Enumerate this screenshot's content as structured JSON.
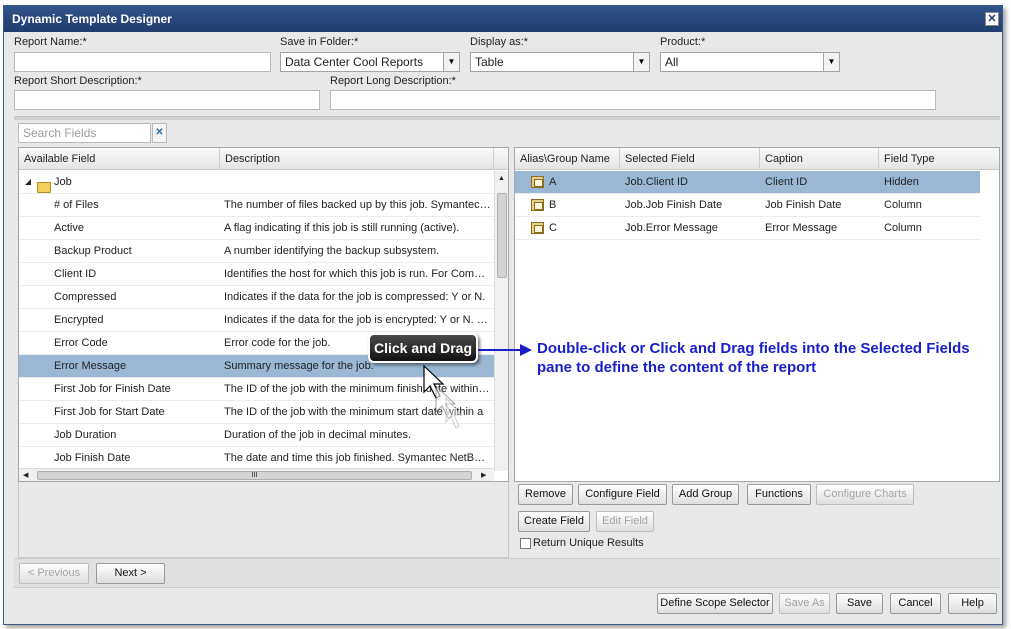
{
  "window": {
    "title": "Dynamic Template Designer",
    "close_glyph": "✕"
  },
  "form": {
    "report_name_label": "Report Name:*",
    "report_name_value": "",
    "save_in_folder_label": "Save in Folder:*",
    "save_in_folder_value": "Data Center Cool Reports",
    "display_as_label": "Display as:*",
    "display_as_value": "Table",
    "product_label": "Product:*",
    "product_value": "All",
    "short_desc_label": "Report Short Description:*",
    "short_desc_value": "",
    "long_desc_label": "Report Long Description:*",
    "long_desc_value": ""
  },
  "search": {
    "placeholder": "Search Fields",
    "clear_glyph": "✕"
  },
  "available": {
    "headers": [
      "Available Field",
      "Description"
    ],
    "group": "Job",
    "rows": [
      {
        "field": "# of Files",
        "desc": "The number of files backed up by this job. Symantec NetBackup"
      },
      {
        "field": "Active",
        "desc": "A flag indicating if this job is still running (active)."
      },
      {
        "field": "Backup Product",
        "desc": "A number identifying the backup subsystem."
      },
      {
        "field": "Client ID",
        "desc": "Identifies the host for which this job is run. For Commvault"
      },
      {
        "field": "Compressed",
        "desc": "Indicates if the data for the job is compressed: Y or N."
      },
      {
        "field": "Encrypted",
        "desc": "Indicates if the data for the job is encrypted: Y or N. Supported"
      },
      {
        "field": "Error Code",
        "desc": "Error code for the job."
      },
      {
        "field": "Error Message",
        "desc": "Summary message for the job."
      },
      {
        "field": "First Job for Finish Date",
        "desc": "The ID of the job with the minimum finish date within the"
      },
      {
        "field": "First Job for Start Date",
        "desc": "The ID of the job with the minimum start date within a"
      },
      {
        "field": "Job Duration",
        "desc": "Duration of the job in decimal minutes."
      },
      {
        "field": "Job Finish Date",
        "desc": "The date and time this job finished. Symantec NetBackup"
      }
    ],
    "selected_index": 7,
    "hscroll_grip": "III"
  },
  "selected": {
    "headers": [
      "Alias\\Group Name",
      "Selected Field",
      "Caption",
      "Field Type"
    ],
    "rows": [
      {
        "alias": "A",
        "field": "Job.Client ID",
        "caption": "Client ID",
        "type": "Hidden"
      },
      {
        "alias": "B",
        "field": "Job.Job Finish Date",
        "caption": "Job Finish Date",
        "type": "Column"
      },
      {
        "alias": "C",
        "field": "Job.Error Message",
        "caption": "Error Message",
        "type": "Column"
      }
    ]
  },
  "buttons": {
    "remove": "Remove",
    "configure_field": "Configure Field",
    "add_group": "Add Group",
    "functions": "Functions",
    "configure_charts": "Configure Charts",
    "create_field": "Create Field",
    "edit_field": "Edit Field",
    "return_unique": "Return Unique Results",
    "previous": "< Previous",
    "next": "Next >",
    "define_scope": "Define Scope Selector",
    "save_as": "Save As",
    "save": "Save",
    "cancel": "Cancel",
    "help": "Help"
  },
  "overlay": {
    "callout": "Click and Drag",
    "annotation": "Double-click or Click and Drag fields into the Selected Fields pane to define the content of the report"
  },
  "colors": {
    "titlebar": "#1f3d6e",
    "selection": "#9ab8d4",
    "annotation": "#1a20c8"
  }
}
